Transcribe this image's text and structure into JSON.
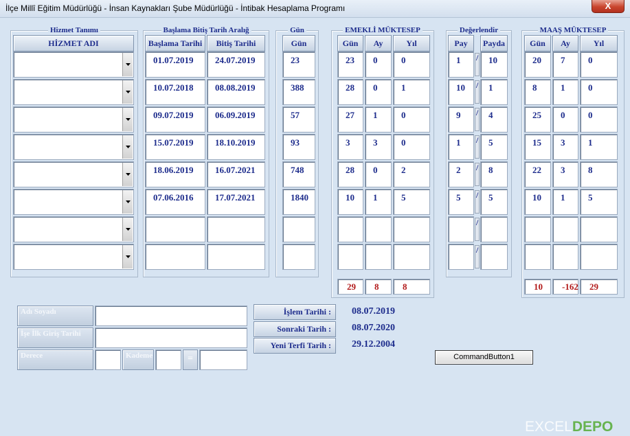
{
  "window": {
    "title": "İlçe Millî Eğitim Müdürlüğü - İnsan Kaynakları Şube Müdürlüğü - İntibak Hesaplama Programı",
    "close_glyph": "X"
  },
  "groups": {
    "hizmet": "Hizmet Tanımı",
    "tarih": "Başlama Bitiş Tarih Aralığ",
    "gun": "Gün",
    "emekli": "EMEKLİ MÜKTESEP",
    "degerlendir": "Değerlendir",
    "maas": "MAAŞ MÜKTESEP"
  },
  "headers": {
    "hizmet_adi": "HİZMET ADI",
    "baslama": "Başlama Tarihi",
    "bitis": "Bitiş Tarihi",
    "gun": "Gün",
    "emekli_gun": "Gün",
    "emekli_ay": "Ay",
    "emekli_yil": "Yıl",
    "pay": "Pay",
    "payda": "Payda",
    "maas_gun": "Gün",
    "maas_ay": "Ay",
    "maas_yil": "Yıl"
  },
  "rows": [
    {
      "baslama": "01.07.2019",
      "bitis": "24.07.2019",
      "gun": "23",
      "e_gun": "23",
      "e_ay": "0",
      "e_yil": "0",
      "pay": "1",
      "payda": "10",
      "m_gun": "20",
      "m_ay": "7",
      "m_yil": "0"
    },
    {
      "baslama": "10.07.2018",
      "bitis": "08.08.2019",
      "gun": "388",
      "e_gun": "28",
      "e_ay": "0",
      "e_yil": "1",
      "pay": "10",
      "payda": "1",
      "m_gun": "8",
      "m_ay": "1",
      "m_yil": "0"
    },
    {
      "baslama": "09.07.2019",
      "bitis": "06.09.2019",
      "gun": "57",
      "e_gun": "27",
      "e_ay": "1",
      "e_yil": "0",
      "pay": "9",
      "payda": "4",
      "m_gun": "25",
      "m_ay": "0",
      "m_yil": "0"
    },
    {
      "baslama": "15.07.2019",
      "bitis": "18.10.2019",
      "gun": "93",
      "e_gun": "3",
      "e_ay": "3",
      "e_yil": "0",
      "pay": "1",
      "payda": "5",
      "m_gun": "15",
      "m_ay": "3",
      "m_yil": "1"
    },
    {
      "baslama": "18.06.2019",
      "bitis": "16.07.2021",
      "gun": "748",
      "e_gun": "28",
      "e_ay": "0",
      "e_yil": "2",
      "pay": "2",
      "payda": "8",
      "m_gun": "22",
      "m_ay": "3",
      "m_yil": "8"
    },
    {
      "baslama": "07.06.2016",
      "bitis": "17.07.2021",
      "gun": "1840",
      "e_gun": "10",
      "e_ay": "1",
      "e_yil": "5",
      "pay": "5",
      "payda": "5",
      "m_gun": "10",
      "m_ay": "1",
      "m_yil": "5"
    },
    {
      "baslama": "",
      "bitis": "",
      "gun": "",
      "e_gun": "",
      "e_ay": "",
      "e_yil": "",
      "pay": "",
      "payda": "",
      "m_gun": "",
      "m_ay": "",
      "m_yil": ""
    },
    {
      "baslama": "",
      "bitis": "",
      "gun": "",
      "e_gun": "",
      "e_ay": "",
      "e_yil": "",
      "pay": "",
      "payda": "",
      "m_gun": "",
      "m_ay": "",
      "m_yil": ""
    }
  ],
  "slash_glyph": "/",
  "totals": {
    "emekli": {
      "gun": "29",
      "ay": "8",
      "yil": "8"
    },
    "maas": {
      "gun": "10",
      "ay": "-162",
      "yil": "29"
    }
  },
  "personal": {
    "adi_soyadi": "Adı Soyadı",
    "ise_giris": "İşe İlk Giriş Tarihi",
    "derece": "Derece",
    "kademe": "Kademe",
    "equals": "="
  },
  "info": {
    "islem_label": "İşlem Tarihi :",
    "islem_value": "08.07.2019",
    "sonraki_label": "Sonraki Tarih :",
    "sonraki_value": "08.07.2020",
    "terfi_label": "Yeni Terfi Tarih :",
    "terfi_value": "29.12.2004"
  },
  "command_button": "CommandButton1",
  "watermark": {
    "left": "EXCEL",
    "right": "DEPO"
  },
  "colors": {
    "label_text": "#1d2c8c",
    "total_text": "#b21a1a",
    "background": "#d7e4f2"
  }
}
